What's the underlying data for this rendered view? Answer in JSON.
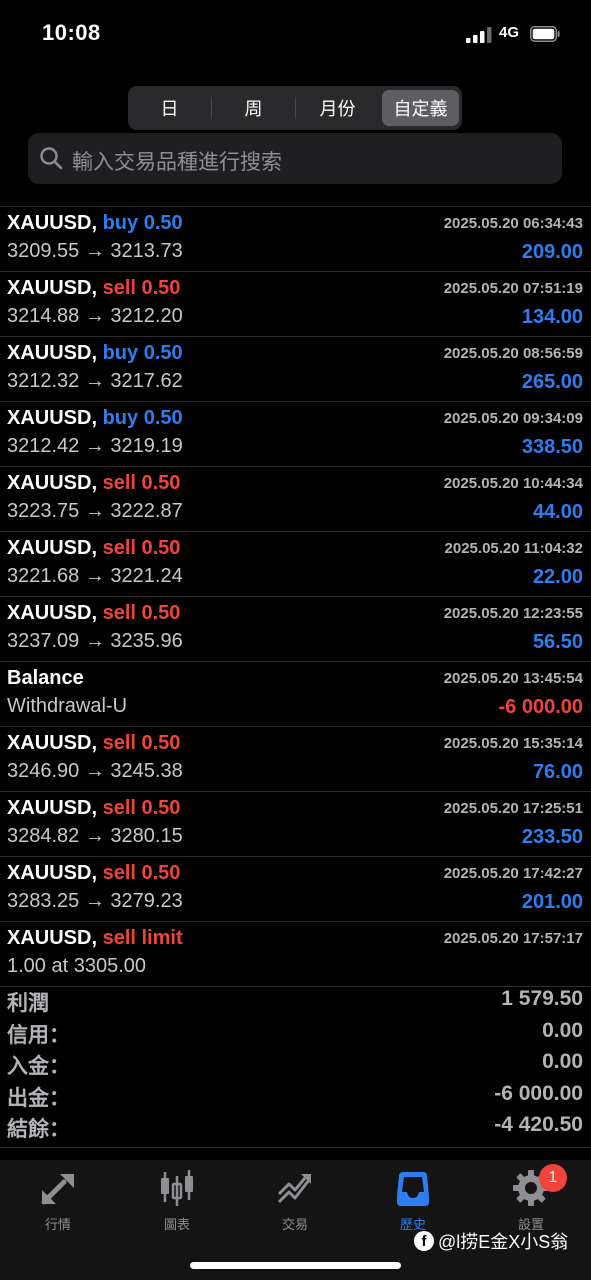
{
  "status_bar": {
    "time": "10:08",
    "network": "4G"
  },
  "segments": [
    {
      "label": "日",
      "active": false
    },
    {
      "label": "周",
      "active": false
    },
    {
      "label": "月份",
      "active": false
    },
    {
      "label": "自定義",
      "active": true
    }
  ],
  "search": {
    "placeholder": "輸入交易品種進行搜索"
  },
  "rows": [
    {
      "symbol": "XAUUSD,",
      "side": "buy 0.50",
      "side_type": "buy",
      "prices": "3209.55 → 3213.73",
      "date": "2025.05.20 06:34:43",
      "pl": "209.00",
      "pl_type": "pos"
    },
    {
      "symbol": "XAUUSD,",
      "side": "sell 0.50",
      "side_type": "sell",
      "prices": "3214.88 → 3212.20",
      "date": "2025.05.20 07:51:19",
      "pl": "134.00",
      "pl_type": "pos"
    },
    {
      "symbol": "XAUUSD,",
      "side": "buy 0.50",
      "side_type": "buy",
      "prices": "3212.32 → 3217.62",
      "date": "2025.05.20 08:56:59",
      "pl": "265.00",
      "pl_type": "pos"
    },
    {
      "symbol": "XAUUSD,",
      "side": "buy 0.50",
      "side_type": "buy",
      "prices": "3212.42 → 3219.19",
      "date": "2025.05.20 09:34:09",
      "pl": "338.50",
      "pl_type": "pos"
    },
    {
      "symbol": "XAUUSD,",
      "side": "sell 0.50",
      "side_type": "sell",
      "prices": "3223.75 → 3222.87",
      "date": "2025.05.20 10:44:34",
      "pl": "44.00",
      "pl_type": "pos"
    },
    {
      "symbol": "XAUUSD,",
      "side": "sell 0.50",
      "side_type": "sell",
      "prices": "3221.68 → 3221.24",
      "date": "2025.05.20 11:04:32",
      "pl": "22.00",
      "pl_type": "pos"
    },
    {
      "symbol": "XAUUSD,",
      "side": "sell 0.50",
      "side_type": "sell",
      "prices": "3237.09 → 3235.96",
      "date": "2025.05.20 12:23:55",
      "pl": "56.50",
      "pl_type": "pos"
    },
    {
      "symbol": "Balance",
      "side": "",
      "side_type": "none",
      "prices": "Withdrawal-U",
      "date": "2025.05.20 13:45:54",
      "pl": "-6 000.00",
      "pl_type": "neg"
    },
    {
      "symbol": "XAUUSD,",
      "side": "sell 0.50",
      "side_type": "sell",
      "prices": "3246.90 → 3245.38",
      "date": "2025.05.20 15:35:14",
      "pl": "76.00",
      "pl_type": "pos"
    },
    {
      "symbol": "XAUUSD,",
      "side": "sell 0.50",
      "side_type": "sell",
      "prices": "3284.82 → 3280.15",
      "date": "2025.05.20 17:25:51",
      "pl": "233.50",
      "pl_type": "pos"
    },
    {
      "symbol": "XAUUSD,",
      "side": "sell 0.50",
      "side_type": "sell",
      "prices": "3283.25 → 3279.23",
      "date": "2025.05.20 17:42:27",
      "pl": "201.00",
      "pl_type": "pos"
    },
    {
      "symbol": "XAUUSD,",
      "side": "sell limit",
      "side_type": "sell",
      "prices": "1.00 at 3305.00",
      "date": "2025.05.20 17:57:17",
      "pl": "",
      "pl_type": "pos"
    }
  ],
  "summary": [
    {
      "label": "利潤",
      "value": "1 579.50"
    },
    {
      "label": "信用：",
      "value": "0.00"
    },
    {
      "label": "入金：",
      "value": "0.00"
    },
    {
      "label": "出金：",
      "value": "-6 000.00"
    },
    {
      "label": "結餘：",
      "value": "-4 420.50"
    }
  ],
  "tabs": [
    {
      "label": "行情",
      "icon": "quotes-icon",
      "active": false
    },
    {
      "label": "圖表",
      "icon": "chart-candles-icon",
      "active": false
    },
    {
      "label": "交易",
      "icon": "trade-icon",
      "active": false
    },
    {
      "label": "歷史",
      "icon": "history-tray-icon",
      "active": true
    },
    {
      "label": "設置",
      "icon": "gear-icon",
      "active": false
    }
  ],
  "settings_badge": "1",
  "watermark": "@l捞E金X小S翁",
  "colors": {
    "buy": "#2d7ef0",
    "sell": "#f0443a",
    "accent": "#2d7ef0"
  }
}
